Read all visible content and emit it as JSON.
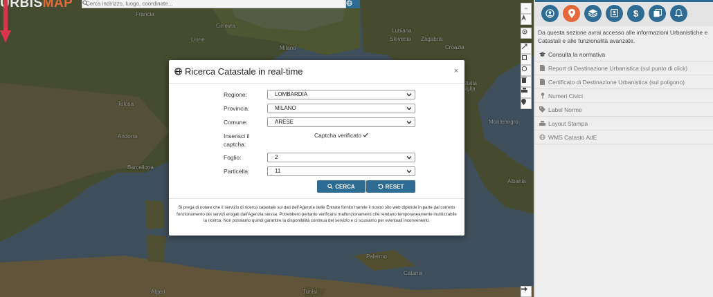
{
  "logo": {
    "part1": "URBIS",
    "part2": "MAP"
  },
  "search": {
    "placeholder": "Cerca indirizzo, luogo, coordinate..."
  },
  "map": {
    "labels": [
      "Francia",
      "Ginevra",
      "Lione",
      "Milano",
      "Lubiana",
      "Slovenia",
      "Zagabria",
      "Croazia",
      "Tolosa",
      "Andorra",
      "Barcellona",
      "Montenegro",
      "Palermo",
      "Catania",
      "Algeri",
      "Tunisi",
      "Albania",
      "Italia",
      "Iglia"
    ]
  },
  "panel": {
    "intro": "Da questa sezione avrai accesso alle informazioni Urbanistiche e Catastali e alle funzionalità avanzate.",
    "items": [
      {
        "label": "Consulta la normativa",
        "icon": "graduation-cap-icon"
      },
      {
        "label": "Report di Destinazione Urbanistica (sul punto di click)",
        "icon": "file-icon"
      },
      {
        "label": "Certificato di Destinazione Urbanistica (sul poligono)",
        "icon": "file-icon"
      },
      {
        "label": "Numeri Civici",
        "icon": "map-pin-icon"
      },
      {
        "label": "Label Norme",
        "icon": "tag-icon"
      },
      {
        "label": "Layout Stampa",
        "icon": "print-icon"
      },
      {
        "label": "WMS Catasto AdE",
        "icon": "globe-icon"
      }
    ],
    "icon_buttons": [
      "user-circle-icon",
      "map-marker-icon",
      "layers-icon",
      "contact-card-icon",
      "dollar-icon",
      "copy-icon",
      "bell-icon"
    ]
  },
  "modal": {
    "title": "Ricerca Catastale in real-time",
    "close": "×",
    "fields": {
      "regione": {
        "label": "Regione:",
        "value": "LOMBARDIA"
      },
      "provincia": {
        "label": "Provincia:",
        "value": "MILANO"
      },
      "comune": {
        "label": "Comune:",
        "value": "ARESE"
      },
      "captcha": {
        "label": "Inserisci il captcha:",
        "status": "Captcha verificato"
      },
      "foglio": {
        "label": "Foglio:",
        "value": "2"
      },
      "particella": {
        "label": "Particella:",
        "value": "11"
      }
    },
    "buttons": {
      "search": "CERCA",
      "reset": "RESET"
    },
    "note": "Si prega di notare che il servizio di ricerca catastale sui dati dell'Agenzia delle Entrate fornito tramite il nostro sito web dipende in parte dal corretto funzionamento dei servizi erogati dall'Agenzia stessa. Potrebbero pertanto verificarsi malfunzionamenti che rendano temporaneamente inutilizzabile la ricerca. Non possiamo quindi garantire la disponibilità continua del servizio e ci scusiamo per eventuali inconvenienti."
  },
  "colors": {
    "accent": "#2e6c93",
    "active": "#e5683b",
    "arrow": "#d9344c"
  }
}
